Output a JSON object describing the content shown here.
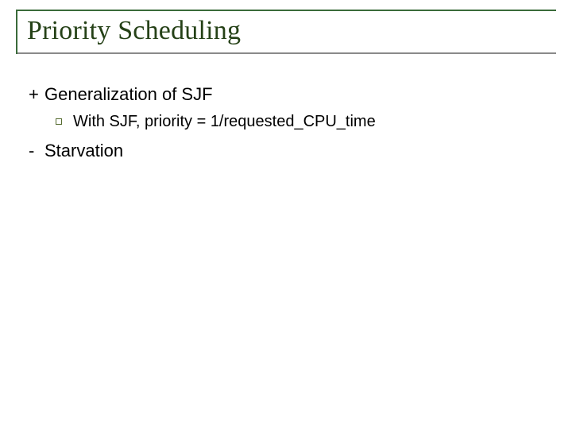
{
  "title": "Priority Scheduling",
  "points": [
    {
      "prefix": "+",
      "text": "Generalization of SJF"
    },
    {
      "prefix": "-",
      "text": "Starvation"
    }
  ],
  "sub": {
    "text": "With SJF, priority = 1/requested_CPU_time"
  }
}
